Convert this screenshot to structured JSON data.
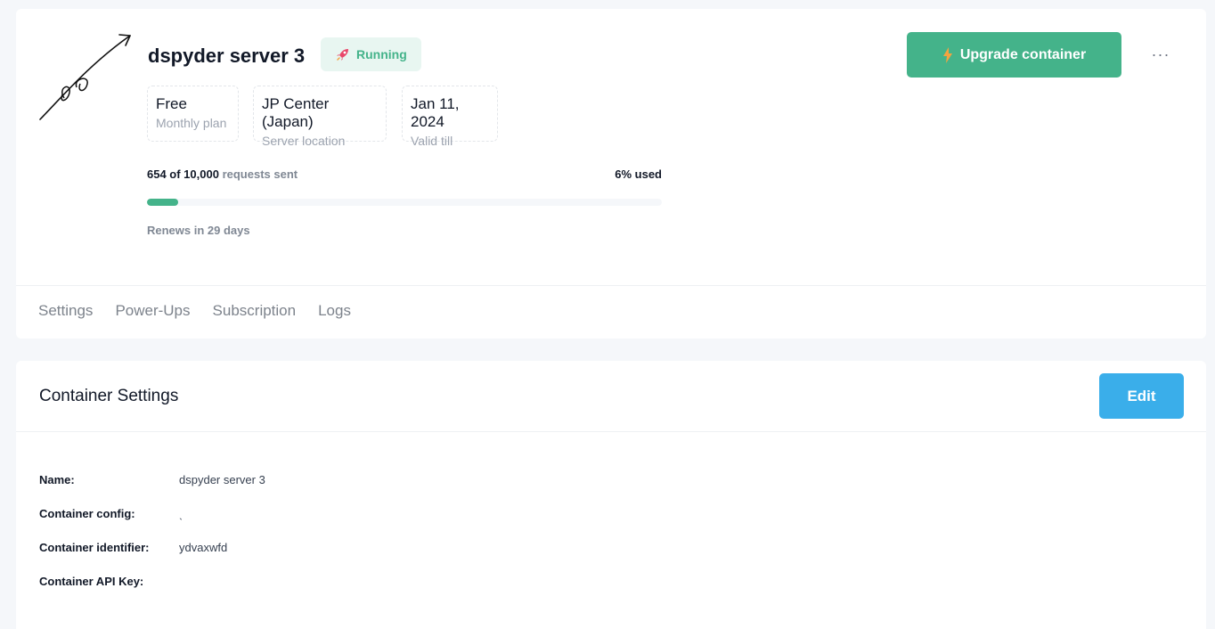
{
  "server": {
    "name": "dspyder server 3",
    "status": "Running"
  },
  "info": [
    {
      "value": "Free",
      "label": "Monthly plan"
    },
    {
      "value": "JP Center (Japan)",
      "label": "Server location"
    },
    {
      "value": "Jan 11, 2024",
      "label": "Valid till"
    }
  ],
  "usage": {
    "sent": "654 of 10,000",
    "sent_suffix": "requests sent",
    "percent_label": "6% used",
    "fraction": 0.06,
    "renews": "Renews in 29 days"
  },
  "actions": {
    "upgrade_label": "Upgrade container",
    "more_label": "···"
  },
  "tabs": [
    {
      "label": "Settings",
      "active": true
    },
    {
      "label": "Power-Ups",
      "active": false
    },
    {
      "label": "Subscription",
      "active": false
    },
    {
      "label": "Logs",
      "active": false
    }
  ],
  "settings": {
    "title": "Container Settings",
    "edit_label": "Edit",
    "fields": [
      {
        "key": "Name:",
        "value": "dspyder server 3"
      },
      {
        "key": "Container config:",
        "value": "ˎ"
      },
      {
        "key": "Container identifier:",
        "value": "ydvaxwfd"
      },
      {
        "key": "Container API Key:",
        "value": ""
      }
    ]
  },
  "colors": {
    "accent_green": "#44b38a",
    "accent_blue": "#3aaeea",
    "background": "#f5f7fa"
  },
  "icons": {
    "status": "rocket-icon",
    "upgrade": "lightning-icon",
    "more": "more-dots-icon"
  }
}
